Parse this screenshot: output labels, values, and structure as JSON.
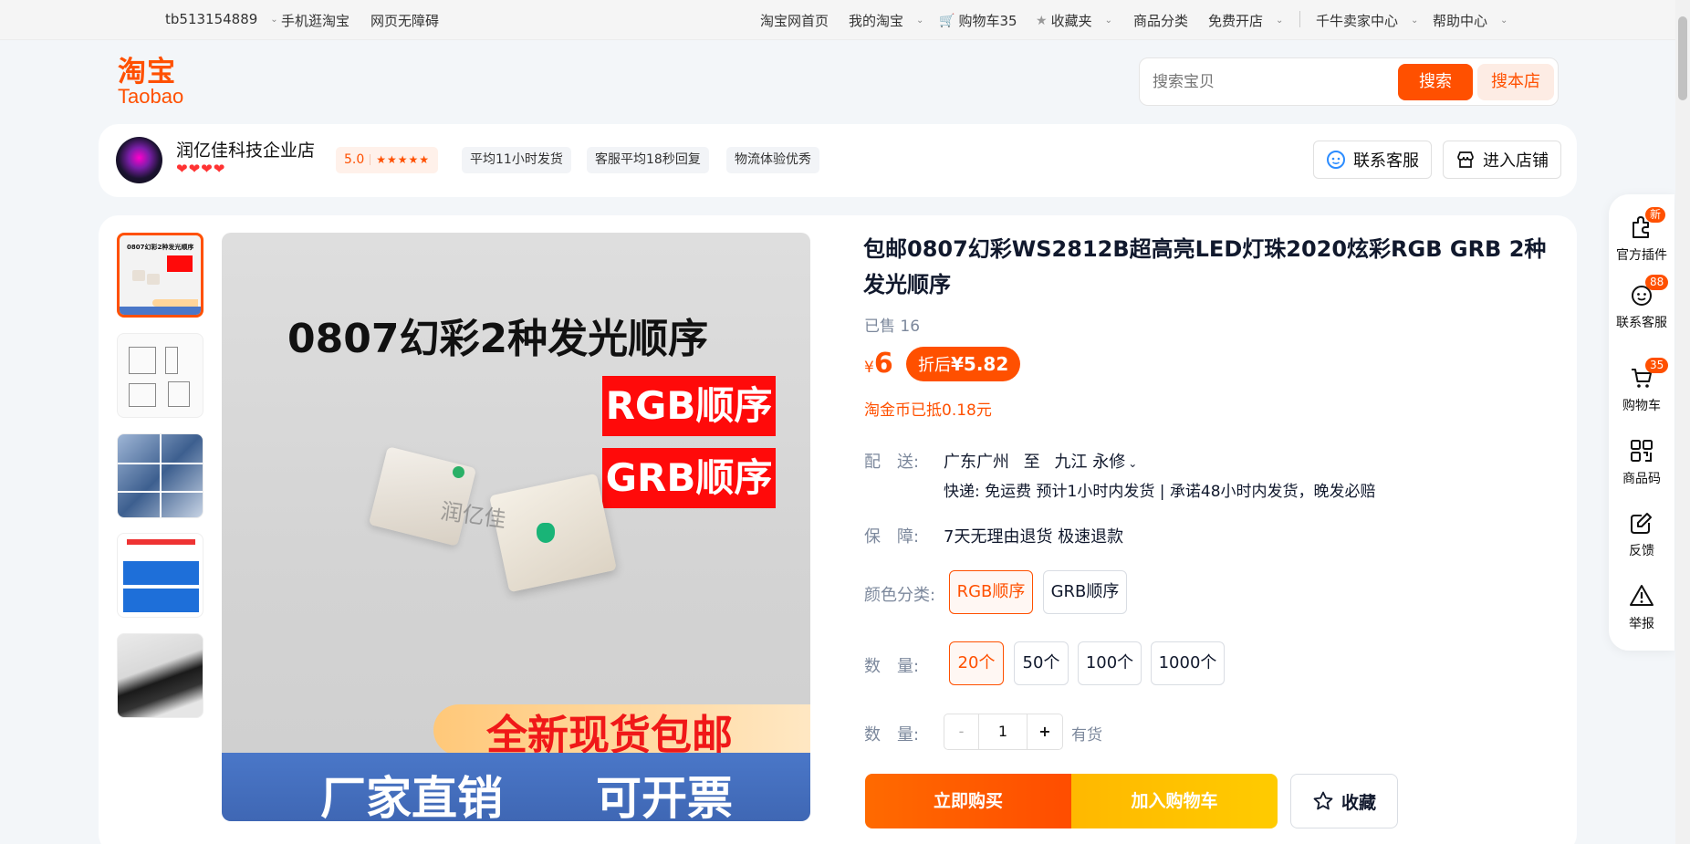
{
  "topbar": {
    "username": "tb513154889",
    "mobile": "手机逛淘宝",
    "accessible": "网页无障碍",
    "home": "淘宝网首页",
    "my_taobao": "我的淘宝",
    "cart": "购物车35",
    "favorites": "收藏夹",
    "categories": "商品分类",
    "open_shop": "免费开店",
    "seller_center": "千牛卖家中心",
    "help": "帮助中心"
  },
  "header": {
    "logo_zh": "淘宝",
    "logo_en": "Taobao",
    "search_placeholder": "搜索宝贝",
    "search_button": "搜索",
    "search_shop_button": "搜本店"
  },
  "shop": {
    "name": "润亿佳科技企业店",
    "hearts": "❤❤❤❤",
    "rating": "5.0",
    "stars": "★★★★★",
    "tags": [
      "平均11小时发货",
      "客服平均18秒回复",
      "物流体验优秀"
    ],
    "contact_button": "联系客服",
    "enter_button": "进入店铺"
  },
  "product": {
    "title": "包邮0807幻彩WS2812B超高亮LED灯珠2020炫彩RGB GRB 2种发光顺序",
    "sold": "已售 16",
    "currency": "¥",
    "price": "6",
    "discount_label": "折后",
    "discount_price": "¥5.82",
    "coin_note": "淘金币已抵0.18元",
    "delivery_label": "配　送:",
    "ship_from": "广东广州",
    "ship_to_word": "至",
    "ship_to": "九江 永修",
    "ship_detail": "快递: 免运费  预计1小时内发货 | 承诺48小时内发货，晚发必赔",
    "guarantee_label": "保　障:",
    "guarantee": "7天无理由退货 极速退款",
    "color_label": "颜色分类:",
    "colors": [
      "RGB顺序",
      "GRB顺序"
    ],
    "qty_opt_label": "数　量:",
    "quantities": [
      "20个",
      "50个",
      "100个",
      "1000个"
    ],
    "qty_label": "数　量:",
    "qty_minus": "-",
    "qty_value": "1",
    "qty_plus": "+",
    "stock": "有货",
    "buy_now": "立即购买",
    "add_cart": "加入购物车",
    "favorite": "收藏"
  },
  "main_image": {
    "title": "0807幻彩2种发光顺序",
    "badge_rgb": "RGB顺序",
    "badge_grb": "GRB顺序",
    "watermark": "润亿佳",
    "banner": "全新现货包邮",
    "bottom_left": "厂家直销",
    "bottom_right": "可开票"
  },
  "sidebar": {
    "plugin": "官方插件",
    "plugin_badge": "新",
    "service": "联系客服",
    "service_badge": "88",
    "cart": "购物车",
    "cart_badge": "35",
    "qrcode": "商品码",
    "feedback": "反馈",
    "report": "举报"
  },
  "colors": {
    "accent": "#ff5000",
    "cart_yellow": "#ffc000",
    "text_muted": "#7c889c"
  }
}
